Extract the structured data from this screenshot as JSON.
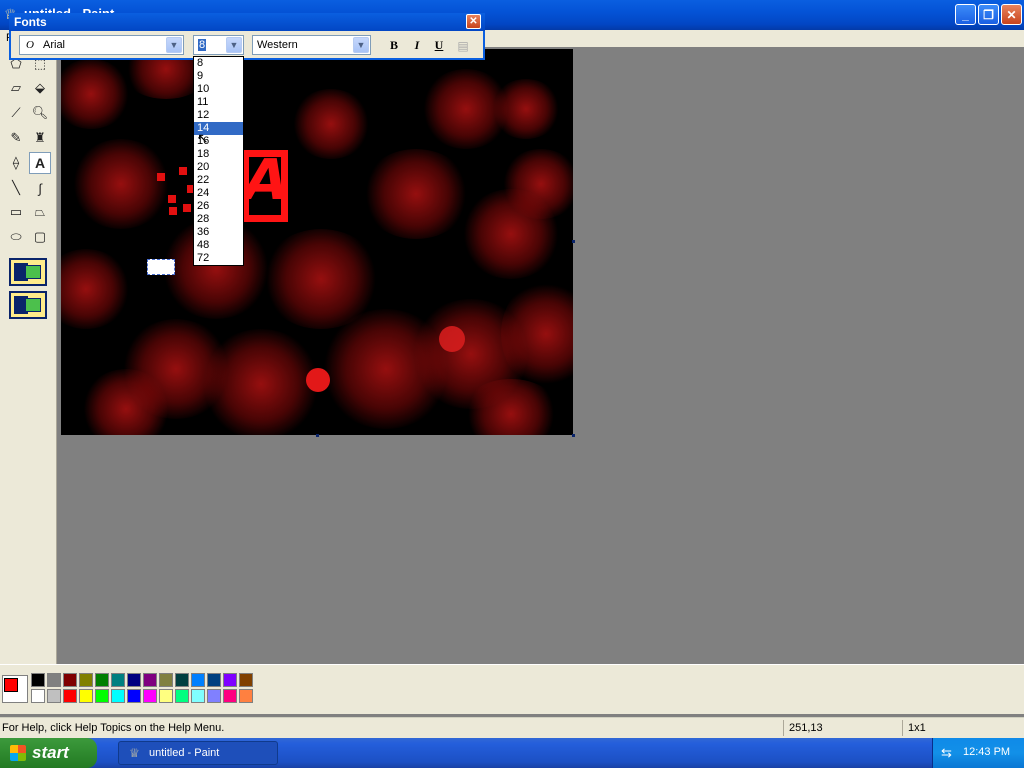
{
  "window": {
    "title": "untitled - Paint",
    "minimize_glyph": "_",
    "maximize_glyph": "❐",
    "close_glyph": "✕"
  },
  "menubar": {
    "first_item": "F"
  },
  "fonts_toolbar": {
    "title": "Fonts",
    "font_name": "Arial",
    "font_size": "8",
    "script": "Western",
    "bold_label": "B",
    "italic_label": "I",
    "underline_label": "U",
    "size_options": [
      "8",
      "9",
      "10",
      "11",
      "12",
      "14",
      "16",
      "18",
      "20",
      "22",
      "24",
      "26",
      "28",
      "36",
      "48",
      "72"
    ],
    "selected_size": "14"
  },
  "tools": [
    "free-select",
    "rect-select",
    "eraser",
    "fill",
    "color-picker",
    "magnifier",
    "pencil",
    "brush",
    "airbrush",
    "text",
    "line",
    "curve",
    "rectangle",
    "polygon",
    "ellipse",
    "rounded-rectangle"
  ],
  "canvas": {
    "letter": "A"
  },
  "palette": {
    "foreground": "#ff0000",
    "background": "#ffffff",
    "row1": [
      "#000000",
      "#808080",
      "#800000",
      "#808000",
      "#008000",
      "#008080",
      "#000080",
      "#800080",
      "#808040",
      "#004040",
      "#0080ff",
      "#004080",
      "#8000ff",
      "#804000"
    ],
    "row2": [
      "#ffffff",
      "#c0c0c0",
      "#ff0000",
      "#ffff00",
      "#00ff00",
      "#00ffff",
      "#0000ff",
      "#ff00ff",
      "#ffff80",
      "#00ff80",
      "#80ffff",
      "#8080ff",
      "#ff0080",
      "#ff8040"
    ]
  },
  "statusbar": {
    "help_text": "For Help, click Help Topics on the Help Menu.",
    "coordinates": "251,13",
    "size": "1x1"
  },
  "taskbar": {
    "start_label": "start",
    "task_label": "untitled - Paint",
    "clock": "12:43 PM"
  }
}
